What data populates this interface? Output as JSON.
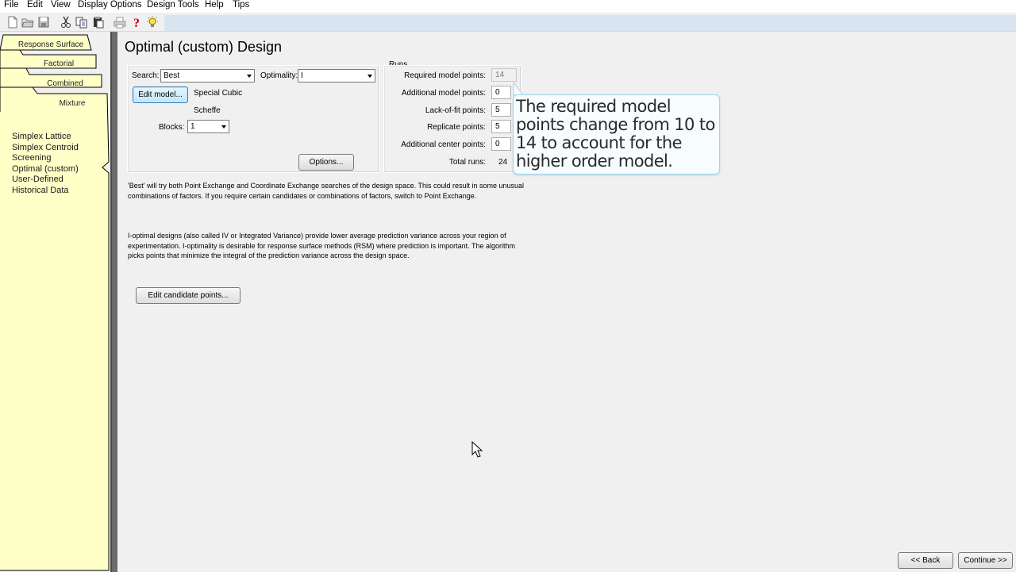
{
  "menu": [
    "File",
    "Edit",
    "View",
    "Display Options",
    "Design Tools",
    "Help",
    "Tips"
  ],
  "toolbar": {
    "icons": [
      "new-file-icon",
      "open-folder-icon",
      "save-icon",
      "cut-icon",
      "copy-icon",
      "paste-icon",
      "print-icon",
      "help-icon",
      "tip-bulb-icon"
    ]
  },
  "left_tabs": [
    "Response Surface",
    "Factorial",
    "Combined",
    "Mixture"
  ],
  "nav_items": [
    "Simplex Lattice",
    "Simplex Centroid",
    "Screening",
    "Optimal (custom)",
    "User-Defined",
    "Historical Data"
  ],
  "page_title": "Optimal (custom) Design",
  "design_box": {
    "search_label": "Search:",
    "search_value": "Best",
    "optimality_label": "Optimality:",
    "optimality_value": "I",
    "edit_model_label": "Edit model...",
    "model_name": "Special Cubic",
    "model_type": "Scheffe",
    "blocks_label": "Blocks:",
    "blocks_value": "1",
    "options_label": "Options..."
  },
  "runs": {
    "heading": "Runs",
    "required_label": "Required model points:",
    "required_value": "14",
    "additional_label": "Additional model points:",
    "additional_value": "0",
    "lof_label": "Lack-of-fit points:",
    "lof_value": "5",
    "replicate_label": "Replicate points:",
    "replicate_value": "5",
    "center_label": "Additional center points:",
    "center_value": "0",
    "total_label": "Total runs:",
    "total_value": "24"
  },
  "callout": "The required model points change from 10 to 14 to account for the higher order model.",
  "paragraph_best": "'Best' will try both Point Exchange and Coordinate Exchange searches of the design space. This could result in some unusual combinations of factors. If you require certain candidates or combinations of factors, switch to Point Exchange.",
  "paragraph_ioptimal": "I-optimal designs (also called IV or Integrated Variance) provide lower average prediction variance across your region of experimentation.  I-optimality is desirable for response surface methods (RSM) where prediction is important.  The algorithm picks points that minimize the integral of the prediction variance across the design space.",
  "edit_candidates_label": "Edit candidate points...",
  "back_label": "<< Back",
  "continue_label": "Continue >>",
  "colors": {
    "tab_yellow": "#ffffc8",
    "callout_border": "#9fd3ec",
    "toolbar_strip": "#d9e4f0"
  }
}
